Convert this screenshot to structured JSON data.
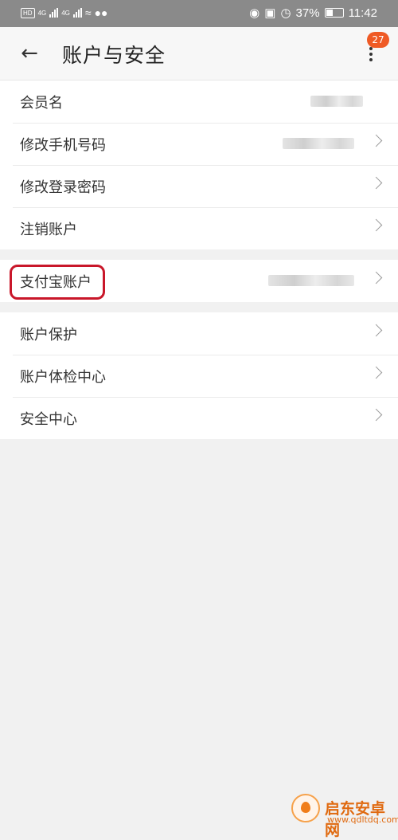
{
  "status_bar": {
    "signal_1": "4G",
    "signal_2": "4G",
    "battery_percent": "37%",
    "time": "11:42",
    "left_icons": [
      "hd-icon",
      "signal-4g-icon",
      "signal-4g-icon",
      "wifi-icon",
      "wechat-icon"
    ],
    "right_icons": [
      "eye-icon",
      "nfc-icon",
      "alarm-icon",
      "battery-icon"
    ]
  },
  "header": {
    "title": "账户与安全",
    "badge_count": "27"
  },
  "group1": [
    {
      "label": "会员名",
      "has_chevron": false
    },
    {
      "label": "修改手机号码",
      "has_chevron": true
    },
    {
      "label": "修改登录密码",
      "has_chevron": true
    },
    {
      "label": "注销账户",
      "has_chevron": true
    }
  ],
  "group2": [
    {
      "label": "支付宝账户",
      "has_chevron": true
    }
  ],
  "group3": [
    {
      "label": "账户保护",
      "has_chevron": true
    },
    {
      "label": "账户体检中心",
      "has_chevron": true
    },
    {
      "label": "安全中心",
      "has_chevron": true
    }
  ],
  "watermark": {
    "name": "启东安卓网",
    "url": "www.qdltdq.com"
  },
  "colors": {
    "accent_badge": "#ef5a25",
    "highlight_box": "#c9172a"
  }
}
